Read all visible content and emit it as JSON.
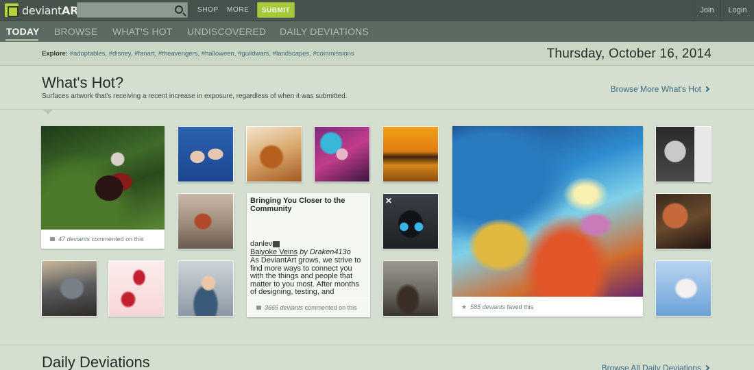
{
  "header": {
    "logo_text_light": "deviant",
    "logo_text_bold": "ART",
    "search_placeholder": "",
    "shop": "SHOP",
    "more": "MORE",
    "submit": "SUBMIT",
    "join": "Join",
    "login": "Login"
  },
  "tabs": [
    {
      "label": "TODAY",
      "active": true
    },
    {
      "label": "BROWSE"
    },
    {
      "label": "WHAT'S HOT"
    },
    {
      "label": "UNDISCOVERED"
    },
    {
      "label": "DAILY DEVIATIONS"
    }
  ],
  "explore": {
    "label": "Explore:",
    "tags": [
      "#adoptables",
      "#disney",
      "#fanart",
      "#theavengers",
      "#halloween",
      "#guildwars",
      "#landscapes",
      "#commissions"
    ]
  },
  "date": "Thursday, October 16, 2014",
  "whats_hot": {
    "title": "What's Hot?",
    "subtitle": "Surfaces artwork that's receiving a recent increase in exposure, regardless of when it was submitted.",
    "browse_more": "Browse More What's Hot"
  },
  "cards": {
    "feature_left_count": "47 deviants",
    "feature_left_suffix": "commented on this",
    "feature_right_count": "585 deviants",
    "feature_right_suffix": "faved this"
  },
  "text_card": {
    "title": "Bringing You Closer to the Community",
    "author": "danlev",
    "link_title": "Baiyoke Veins",
    "by": "by",
    "link_author": "Draken413o",
    "body": "As DeviantArt grows, we strive to find more ways to connect you with the things and people that matter to you most. After months of designing, testing, and",
    "foot_count": "3665 deviants",
    "foot_suffix": "commented on this"
  },
  "daily": {
    "title": "Daily Deviations",
    "browse_all": "Browse All Daily Deviations"
  },
  "colors": {
    "background": "#d4dfd0",
    "topbar": "#46534c",
    "tabbar": "#5b6b61",
    "submit": "#a6c83b",
    "link": "#3a6b80"
  },
  "icons": {
    "search": "search-icon",
    "comment": "comment-icon",
    "star": "star-icon",
    "chevron": "chevron-right-icon",
    "close": "close-icon"
  }
}
